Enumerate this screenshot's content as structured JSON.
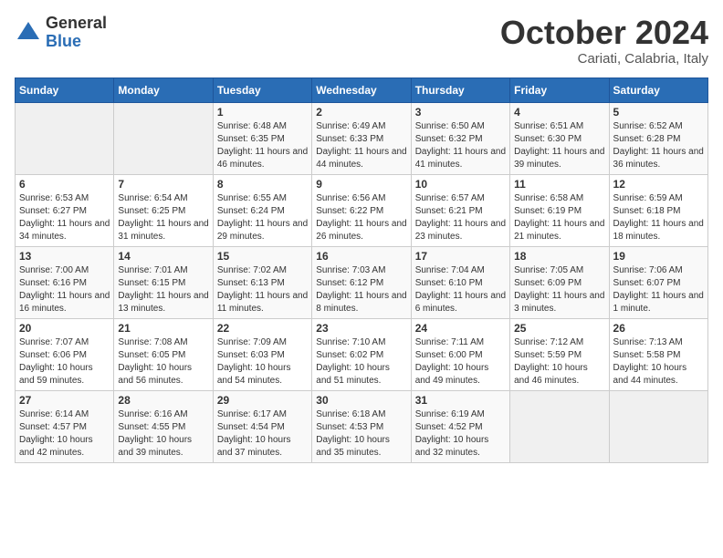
{
  "logo": {
    "general": "General",
    "blue": "Blue",
    "icon": "▶"
  },
  "title": "October 2024",
  "subtitle": "Cariati, Calabria, Italy",
  "headers": [
    "Sunday",
    "Monday",
    "Tuesday",
    "Wednesday",
    "Thursday",
    "Friday",
    "Saturday"
  ],
  "weeks": [
    [
      {
        "day": "",
        "info": ""
      },
      {
        "day": "",
        "info": ""
      },
      {
        "day": "1",
        "info": "Sunrise: 6:48 AM\nSunset: 6:35 PM\nDaylight: 11 hours and 46 minutes."
      },
      {
        "day": "2",
        "info": "Sunrise: 6:49 AM\nSunset: 6:33 PM\nDaylight: 11 hours and 44 minutes."
      },
      {
        "day": "3",
        "info": "Sunrise: 6:50 AM\nSunset: 6:32 PM\nDaylight: 11 hours and 41 minutes."
      },
      {
        "day": "4",
        "info": "Sunrise: 6:51 AM\nSunset: 6:30 PM\nDaylight: 11 hours and 39 minutes."
      },
      {
        "day": "5",
        "info": "Sunrise: 6:52 AM\nSunset: 6:28 PM\nDaylight: 11 hours and 36 minutes."
      }
    ],
    [
      {
        "day": "6",
        "info": "Sunrise: 6:53 AM\nSunset: 6:27 PM\nDaylight: 11 hours and 34 minutes."
      },
      {
        "day": "7",
        "info": "Sunrise: 6:54 AM\nSunset: 6:25 PM\nDaylight: 11 hours and 31 minutes."
      },
      {
        "day": "8",
        "info": "Sunrise: 6:55 AM\nSunset: 6:24 PM\nDaylight: 11 hours and 29 minutes."
      },
      {
        "day": "9",
        "info": "Sunrise: 6:56 AM\nSunset: 6:22 PM\nDaylight: 11 hours and 26 minutes."
      },
      {
        "day": "10",
        "info": "Sunrise: 6:57 AM\nSunset: 6:21 PM\nDaylight: 11 hours and 23 minutes."
      },
      {
        "day": "11",
        "info": "Sunrise: 6:58 AM\nSunset: 6:19 PM\nDaylight: 11 hours and 21 minutes."
      },
      {
        "day": "12",
        "info": "Sunrise: 6:59 AM\nSunset: 6:18 PM\nDaylight: 11 hours and 18 minutes."
      }
    ],
    [
      {
        "day": "13",
        "info": "Sunrise: 7:00 AM\nSunset: 6:16 PM\nDaylight: 11 hours and 16 minutes."
      },
      {
        "day": "14",
        "info": "Sunrise: 7:01 AM\nSunset: 6:15 PM\nDaylight: 11 hours and 13 minutes."
      },
      {
        "day": "15",
        "info": "Sunrise: 7:02 AM\nSunset: 6:13 PM\nDaylight: 11 hours and 11 minutes."
      },
      {
        "day": "16",
        "info": "Sunrise: 7:03 AM\nSunset: 6:12 PM\nDaylight: 11 hours and 8 minutes."
      },
      {
        "day": "17",
        "info": "Sunrise: 7:04 AM\nSunset: 6:10 PM\nDaylight: 11 hours and 6 minutes."
      },
      {
        "day": "18",
        "info": "Sunrise: 7:05 AM\nSunset: 6:09 PM\nDaylight: 11 hours and 3 minutes."
      },
      {
        "day": "19",
        "info": "Sunrise: 7:06 AM\nSunset: 6:07 PM\nDaylight: 11 hours and 1 minute."
      }
    ],
    [
      {
        "day": "20",
        "info": "Sunrise: 7:07 AM\nSunset: 6:06 PM\nDaylight: 10 hours and 59 minutes."
      },
      {
        "day": "21",
        "info": "Sunrise: 7:08 AM\nSunset: 6:05 PM\nDaylight: 10 hours and 56 minutes."
      },
      {
        "day": "22",
        "info": "Sunrise: 7:09 AM\nSunset: 6:03 PM\nDaylight: 10 hours and 54 minutes."
      },
      {
        "day": "23",
        "info": "Sunrise: 7:10 AM\nSunset: 6:02 PM\nDaylight: 10 hours and 51 minutes."
      },
      {
        "day": "24",
        "info": "Sunrise: 7:11 AM\nSunset: 6:00 PM\nDaylight: 10 hours and 49 minutes."
      },
      {
        "day": "25",
        "info": "Sunrise: 7:12 AM\nSunset: 5:59 PM\nDaylight: 10 hours and 46 minutes."
      },
      {
        "day": "26",
        "info": "Sunrise: 7:13 AM\nSunset: 5:58 PM\nDaylight: 10 hours and 44 minutes."
      }
    ],
    [
      {
        "day": "27",
        "info": "Sunrise: 6:14 AM\nSunset: 4:57 PM\nDaylight: 10 hours and 42 minutes."
      },
      {
        "day": "28",
        "info": "Sunrise: 6:16 AM\nSunset: 4:55 PM\nDaylight: 10 hours and 39 minutes."
      },
      {
        "day": "29",
        "info": "Sunrise: 6:17 AM\nSunset: 4:54 PM\nDaylight: 10 hours and 37 minutes."
      },
      {
        "day": "30",
        "info": "Sunrise: 6:18 AM\nSunset: 4:53 PM\nDaylight: 10 hours and 35 minutes."
      },
      {
        "day": "31",
        "info": "Sunrise: 6:19 AM\nSunset: 4:52 PM\nDaylight: 10 hours and 32 minutes."
      },
      {
        "day": "",
        "info": ""
      },
      {
        "day": "",
        "info": ""
      }
    ]
  ]
}
